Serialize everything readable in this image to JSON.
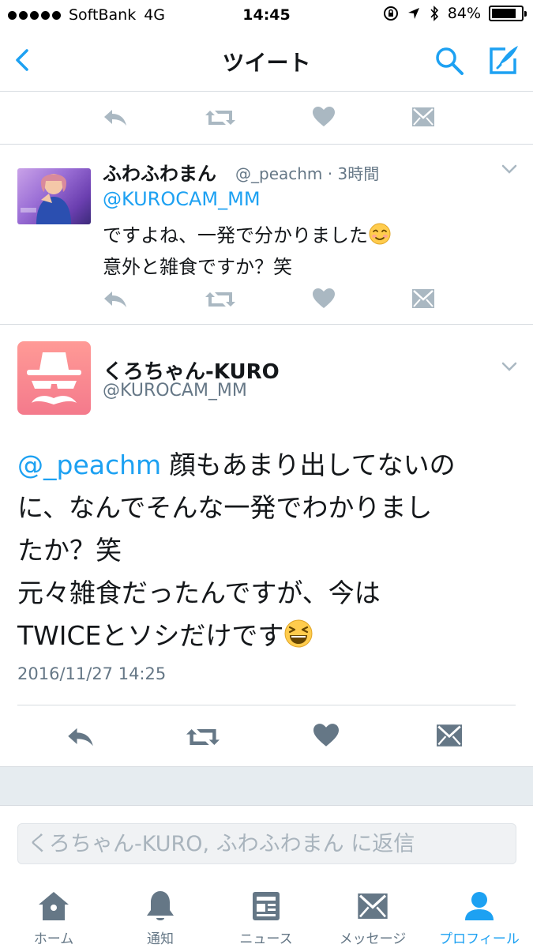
{
  "status_bar": {
    "carrier": "SoftBank",
    "network": "4G",
    "time": "14:45",
    "battery": "84%",
    "battery_level": 0.84
  },
  "nav": {
    "title": "ツイート",
    "back_icon": "chevron-left-icon",
    "search_icon": "search-icon",
    "compose_icon": "compose-icon"
  },
  "reply_tweet": {
    "name": "ふわふわまん",
    "handle_time": "@_peachm · 3時間",
    "mention": "@KUROCAM_MM",
    "line1": "ですよね、一発で分かりました",
    "line2": "意外と雑食ですか？笑"
  },
  "main_tweet": {
    "name": "くろちゃん-KURO",
    "handle": "@KUROCAM_MM",
    "mention": "@_peachm",
    "line1_rest": " 顔もあまり出してないの",
    "line2": "に、なんでそんな一発でわかりまし",
    "line3": "たか？笑",
    "line4": "元々雑食だったんですが、今は",
    "line5": "TWICEとソシだけです",
    "date": "2016/11/27 14:25"
  },
  "reply_box": {
    "placeholder": "くろちゃん-KURO, ふわふわまん に返信"
  },
  "tabs": [
    {
      "label": "ホーム",
      "icon": "home-icon"
    },
    {
      "label": "通知",
      "icon": "bell-icon"
    },
    {
      "label": "ニュース",
      "icon": "news-icon"
    },
    {
      "label": "メッセージ",
      "icon": "envelope-icon"
    },
    {
      "label": "プロフィール",
      "icon": "person-icon"
    }
  ],
  "colors": {
    "accent": "#1da1f2",
    "icon_gray": "#8899a6",
    "text": "#14171a",
    "muted": "#657786"
  }
}
